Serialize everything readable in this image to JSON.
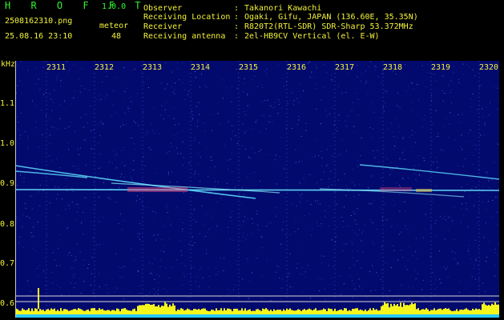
{
  "header": {
    "app_name": "H R O F F T",
    "version": "1.0.0",
    "filename": "2508162310.png",
    "datetime": "25.08.16 23:10",
    "meteor_label": "meteor",
    "meteor_count": "48",
    "observer_label": "Observer",
    "observer_value": "Takanori Kawachi",
    "location_label": "Receiving Location",
    "location_value": "Ogaki, Gifu, JAPAN (136.60E, 35.35N)",
    "receiver_label": "Receiver",
    "receiver_value": "R820T2(RTL-SDR) SDR-Sharp 53.372MHz",
    "antenna_label": "Receiving antenna",
    "antenna_value": "2el-HB9CV Vertical (el. E-W)",
    "separator": ":"
  },
  "axes": {
    "y_unit": "kHz",
    "x_ticks": [
      "2311",
      "2312",
      "2313",
      "2314",
      "2315",
      "2316",
      "2317",
      "2318",
      "2319",
      "2320"
    ],
    "y_ticks": [
      "1.1",
      "1.0",
      "0.9",
      "0.8",
      "0.7",
      "0.6"
    ]
  },
  "colors": {
    "background": "#000000",
    "header_text": "#f2f23a",
    "title_text": "#2ff52f",
    "spectrogram_bg": "#030a6e",
    "trace_main": "#7ff0ff",
    "meteor_highlight": "#ff5080",
    "bottom_bars": "#f5f51e",
    "bottom_fill": "#28c8ff"
  }
}
